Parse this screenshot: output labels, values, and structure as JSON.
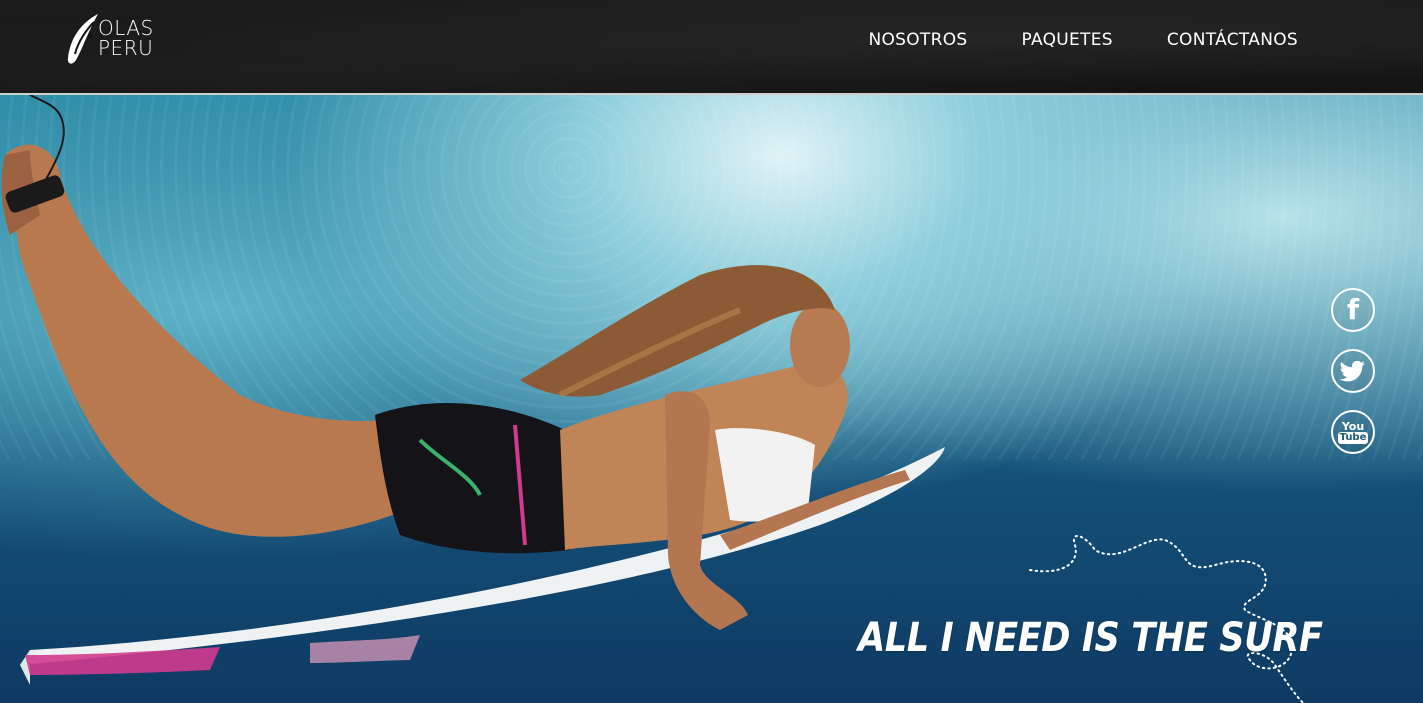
{
  "brand": {
    "logo_line1": "OLAS",
    "logo_line2": "PERU"
  },
  "nav": {
    "items": [
      {
        "label": "NOSOTROS"
      },
      {
        "label": "PAQUETES"
      },
      {
        "label": "CONTÁCTANOS"
      }
    ]
  },
  "hero": {
    "tagline": "ALL I NEED IS THE SURF"
  },
  "social": {
    "facebook_glyph": "f",
    "youtube_top": "You",
    "youtube_bottom": "Tube",
    "icons": [
      "facebook-icon",
      "twitter-icon",
      "youtube-icon"
    ]
  },
  "colors": {
    "header_bg": "#141414",
    "nav_text": "#ffffff",
    "water_deep": "#0e3a63",
    "water_light": "#2a8aa6"
  }
}
